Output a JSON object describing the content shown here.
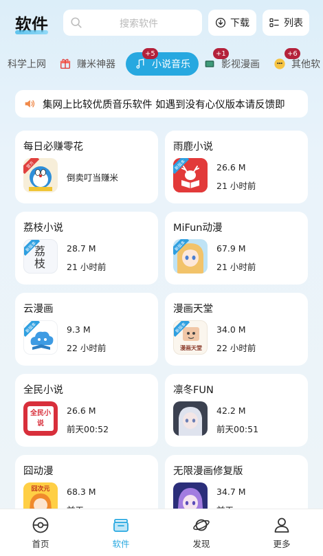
{
  "header": {
    "title": "软件",
    "search_placeholder": "搜索软件",
    "download_label": "下载",
    "list_label": "列表"
  },
  "tabs": [
    {
      "label": "科学上网",
      "badge": ""
    },
    {
      "label": "赚米神器",
      "badge": ""
    },
    {
      "label": "小说音乐",
      "badge": "+5",
      "active": true
    },
    {
      "label": "影视漫画",
      "badge": "+1"
    },
    {
      "label": "其他软",
      "badge": "+6"
    }
  ],
  "notice": {
    "text": "集网上比较优质音乐软件 如遇到没有心仪版本请反馈即"
  },
  "cards": [
    {
      "title": "每日必赚零花",
      "subtitle": "倒卖叮当赚米",
      "size": "",
      "time": "",
      "icon": "doraemon-icon",
      "ribbon": "官方"
    },
    {
      "title": "雨鹿小说",
      "subtitle": "",
      "size": "26.6 M",
      "time": "21 小时前",
      "icon": "deer-reading-icon",
      "ribbon": "新版本"
    },
    {
      "title": "荔枝小说",
      "subtitle": "",
      "size": "28.7 M",
      "time": "21 小时前",
      "icon": "lizhi-book-icon",
      "ribbon": "新版本",
      "icon_text": "荔枝"
    },
    {
      "title": "MiFun动漫",
      "subtitle": "",
      "size": "67.9 M",
      "time": "21 小时前",
      "icon": "anime-girl-icon",
      "ribbon": "新版本"
    },
    {
      "title": "云漫画",
      "subtitle": "",
      "size": "9.3 M",
      "time": "22 小时前",
      "icon": "cloud-comic-icon",
      "ribbon": "新版本"
    },
    {
      "title": "漫画天堂",
      "subtitle": "",
      "size": "34.0 M",
      "time": "22 小时前",
      "icon": "comic-heaven-icon",
      "ribbon": "新版本",
      "icon_text": "漫画天堂"
    },
    {
      "title": "全民小说",
      "subtitle": "",
      "size": "26.6 M",
      "time": "前天00:52",
      "icon": "novel-book-icon",
      "ribbon": "",
      "icon_text": "全民小说"
    },
    {
      "title": "凛冬FUN",
      "subtitle": "",
      "size": "42.2 M",
      "time": "前天00:51",
      "icon": "winter-girl-icon",
      "ribbon": ""
    },
    {
      "title": "囧动漫",
      "subtitle": "",
      "size": "68.3 M",
      "time": "前天",
      "icon": "anime-orange-icon",
      "ribbon": "",
      "icon_text": "囧次元"
    },
    {
      "title": "无限漫画修复版",
      "subtitle": "",
      "size": "34.7 M",
      "time": "前天",
      "icon": "anime-purple-icon",
      "ribbon": ""
    }
  ],
  "nav": [
    {
      "label": "首页"
    },
    {
      "label": "软件",
      "active": true
    },
    {
      "label": "发现"
    },
    {
      "label": "更多"
    }
  ],
  "colors": {
    "accent": "#27a8e0",
    "badge": "#b4213a"
  }
}
